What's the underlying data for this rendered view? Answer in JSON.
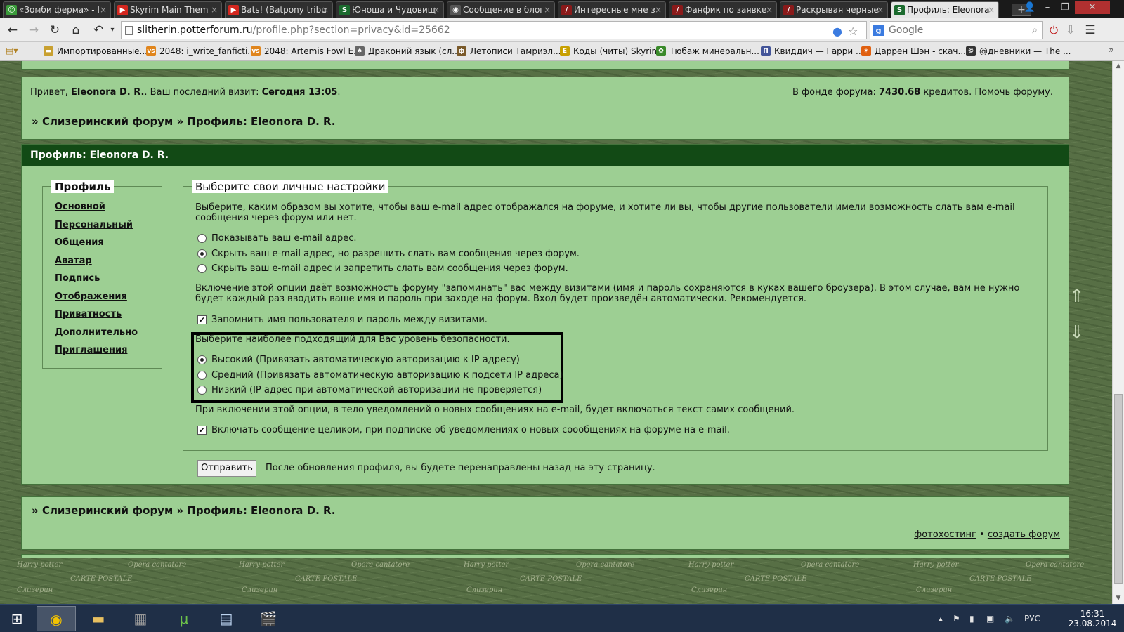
{
  "browser": {
    "tabs": [
      {
        "label": "«Зомби ферма» - I",
        "icon": "zombie-farm-icon",
        "color": "#3a9b3a",
        "glyph": "☺"
      },
      {
        "label": "Skyrim Main Them",
        "icon": "youtube-icon",
        "color": "#d4271f",
        "glyph": "▶"
      },
      {
        "label": "Bats! (Batpony tribu",
        "icon": "youtube-icon",
        "color": "#d4271f",
        "glyph": "▶"
      },
      {
        "label": "Юноша и Чудовищ",
        "icon": "slytherin-s-icon",
        "color": "#1b6b2e",
        "glyph": "S"
      },
      {
        "label": "Сообщение в блог",
        "icon": "diary-icon",
        "color": "#555555",
        "glyph": "◉"
      },
      {
        "label": "Интересные мне з",
        "icon": "ficbook-icon",
        "color": "#8a1a1a",
        "glyph": "/"
      },
      {
        "label": "Фанфик по заявке",
        "icon": "ficbook-icon",
        "color": "#8a1a1a",
        "glyph": "/"
      },
      {
        "label": "Раскрывая черные",
        "icon": "ficbook-icon",
        "color": "#8a1a1a",
        "glyph": "/"
      },
      {
        "label": "Профиль: Eleonora",
        "icon": "slytherin-s-icon",
        "color": "#1b6b2e",
        "glyph": "S"
      }
    ],
    "url_host": "slitherin.potterforum.ru",
    "url_path": "/profile.php?section=privacy&id=25662",
    "search_placeholder": "Google",
    "bookmarks": [
      {
        "label": "Импортированные...",
        "color": "#c8a030",
        "glyph": "▬"
      },
      {
        "label": "2048: i_write_fanficti...",
        "color": "#e0851c",
        "glyph": "vs"
      },
      {
        "label": "2048: Artemis Fowl E...",
        "color": "#e0851c",
        "glyph": "vs"
      },
      {
        "label": "Драконий язык (сл...",
        "color": "#666666",
        "glyph": "♠"
      },
      {
        "label": "Летописи Тамриэл...",
        "color": "#7a5a2a",
        "glyph": "ф"
      },
      {
        "label": "Коды (читы) Skyrim",
        "color": "#c8a000",
        "glyph": "E"
      },
      {
        "label": "Тюбаж минеральн...",
        "color": "#3a8a2a",
        "glyph": "✿"
      },
      {
        "label": "Квиддич — Гарри ...",
        "color": "#445599",
        "glyph": "Π"
      },
      {
        "label": "Даррен Шэн - скач...",
        "color": "#e06010",
        "glyph": "✶"
      },
      {
        "label": "@дневники — The ...",
        "color": "#333333",
        "glyph": "©"
      }
    ]
  },
  "forum": {
    "greeting_prefix": "Привет,",
    "user_name": "Eleonora D. R.",
    "last_visit_label": ". Ваш последний визит:",
    "last_visit_value": "Сегодня 13:05",
    "fund_label": "В фонде форума:",
    "fund_value": "7430.68",
    "fund_suffix": "кредитов.",
    "help_link": "Помочь форуму",
    "breadcrumb_sep": "»",
    "breadcrumb_forum": "Слизеринский форум",
    "breadcrumb_page": "» Профиль: Eleonora D. R.",
    "profile_header": "Профиль: Eleonora D. R.",
    "sidebar_title": "Профиль",
    "sidebar_items": [
      "Основной",
      "Персональный",
      "Общения",
      "Аватар",
      "Подпись",
      "Отображения",
      "Приватность",
      "Дополнительно",
      "Приглашения"
    ],
    "settings_legend": "Выберите свои личные настройки",
    "email_intro": "Выберите, каким образом вы хотите, чтобы ваш e-mail адрес отображался на форуме, и хотите ли вы, чтобы другие пользователи имели возможность слать вам e-mail сообщения через форум или нет.",
    "email_options": [
      {
        "label": "Показывать ваш e-mail адрес.",
        "checked": false
      },
      {
        "label": "Скрыть ваш e-mail адрес, но разрешить слать вам сообщения через форум.",
        "checked": true
      },
      {
        "label": "Скрыть ваш e-mail адрес и запретить слать вам сообщения через форум.",
        "checked": false
      }
    ],
    "remember_intro": "Включение этой опции даёт возможность форуму \"запоминать\" вас между визитами (имя и пароль сохраняются в куках вашего броузера). В этом случае, вам не нужно будет каждый раз вводить ваше имя и пароль при заходе на форум. Вход будет произведён автоматически. Рекомендуется.",
    "remember_label": "Запомнить имя пользователя и пароль между визитами.",
    "remember_checked": true,
    "security_intro": "Выберите наиболее подходящий для Вас уровень безопасности.",
    "security_options": [
      {
        "label": "Высокий (Привязать автоматическую авторизацию к IP адресу)",
        "checked": true
      },
      {
        "label": "Средний (Привязать автоматическую авторизацию к подсети IP адреса)",
        "checked": false
      },
      {
        "label": "Низкий (IP адрес при автоматической авторизации не проверяется)",
        "checked": false
      }
    ],
    "notify_intro": "При включении этой опции, в тело уведомлений о новых сообщениях на e-mail, будет включаться текст самих сообщений.",
    "notify_label": "Включать сообщение целиком, при подписке об уведомлениях о новых соообщениях на форуме на e-mail.",
    "notify_checked": true,
    "submit_label": "Отправить",
    "submit_note": "После обновления профиля, вы будете перенаправлены назад на эту страницу.",
    "footer_link1": "фотохостинг",
    "footer_sep": "•",
    "footer_link2": "создать форум"
  },
  "taskbar": {
    "language": "РУС",
    "time": "16:31",
    "date": "23.08.2014"
  },
  "colors": {
    "panel_bg": "#9dcf93",
    "header_bg": "#124a15",
    "highlight_border": "#000000"
  }
}
